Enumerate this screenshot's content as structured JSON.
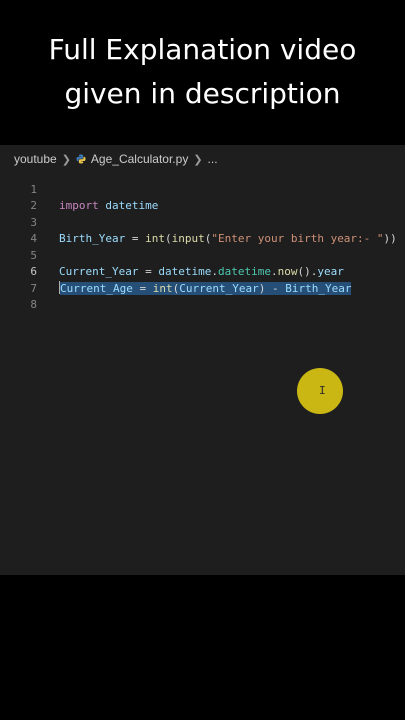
{
  "caption": {
    "line1": "Full Explanation video",
    "line2": "given in description"
  },
  "breadcrumb": {
    "folder": "youtube",
    "file": "Age_Calculator.py",
    "more": "...",
    "file_icon": "python-file-icon"
  },
  "editor": {
    "line_numbers": [
      "1",
      "2",
      "3",
      "4",
      "5",
      "6",
      "7",
      "8"
    ],
    "active_line": 6,
    "code": {
      "line1": {
        "kw": "import",
        "mod": "datetime"
      },
      "line3": {
        "var": "Birth_Year",
        "eq": " = ",
        "fn1": "int",
        "p1": "(",
        "fn2": "input",
        "p2": "(",
        "str": "\"Enter your birth year:- \"",
        "p3": "))"
      },
      "line5": {
        "var": "Current_Year",
        "eq": " = ",
        "mod": "datetime",
        "dot1": ".",
        "cls": "datetime",
        "dot2": ".",
        "fn": "now",
        "call": "()",
        "dot3": ".",
        "attr": "year"
      },
      "line6": {
        "var": "Current_Age",
        "eq": " = ",
        "fn": "int",
        "p1": "(",
        "arg": "Current_Year",
        "p2": ")",
        "minus": " - ",
        "var2": "Birth_Year"
      }
    }
  },
  "cursor": {
    "glyph": "I",
    "highlight_color": "#d4c013"
  },
  "colors": {
    "editor_bg": "#1e1e1e",
    "selection": "#264f78",
    "keyword": "#c586c0",
    "variable": "#9cdcfe",
    "function": "#dcdcaa",
    "class": "#4ec9b0",
    "string": "#ce9178"
  }
}
